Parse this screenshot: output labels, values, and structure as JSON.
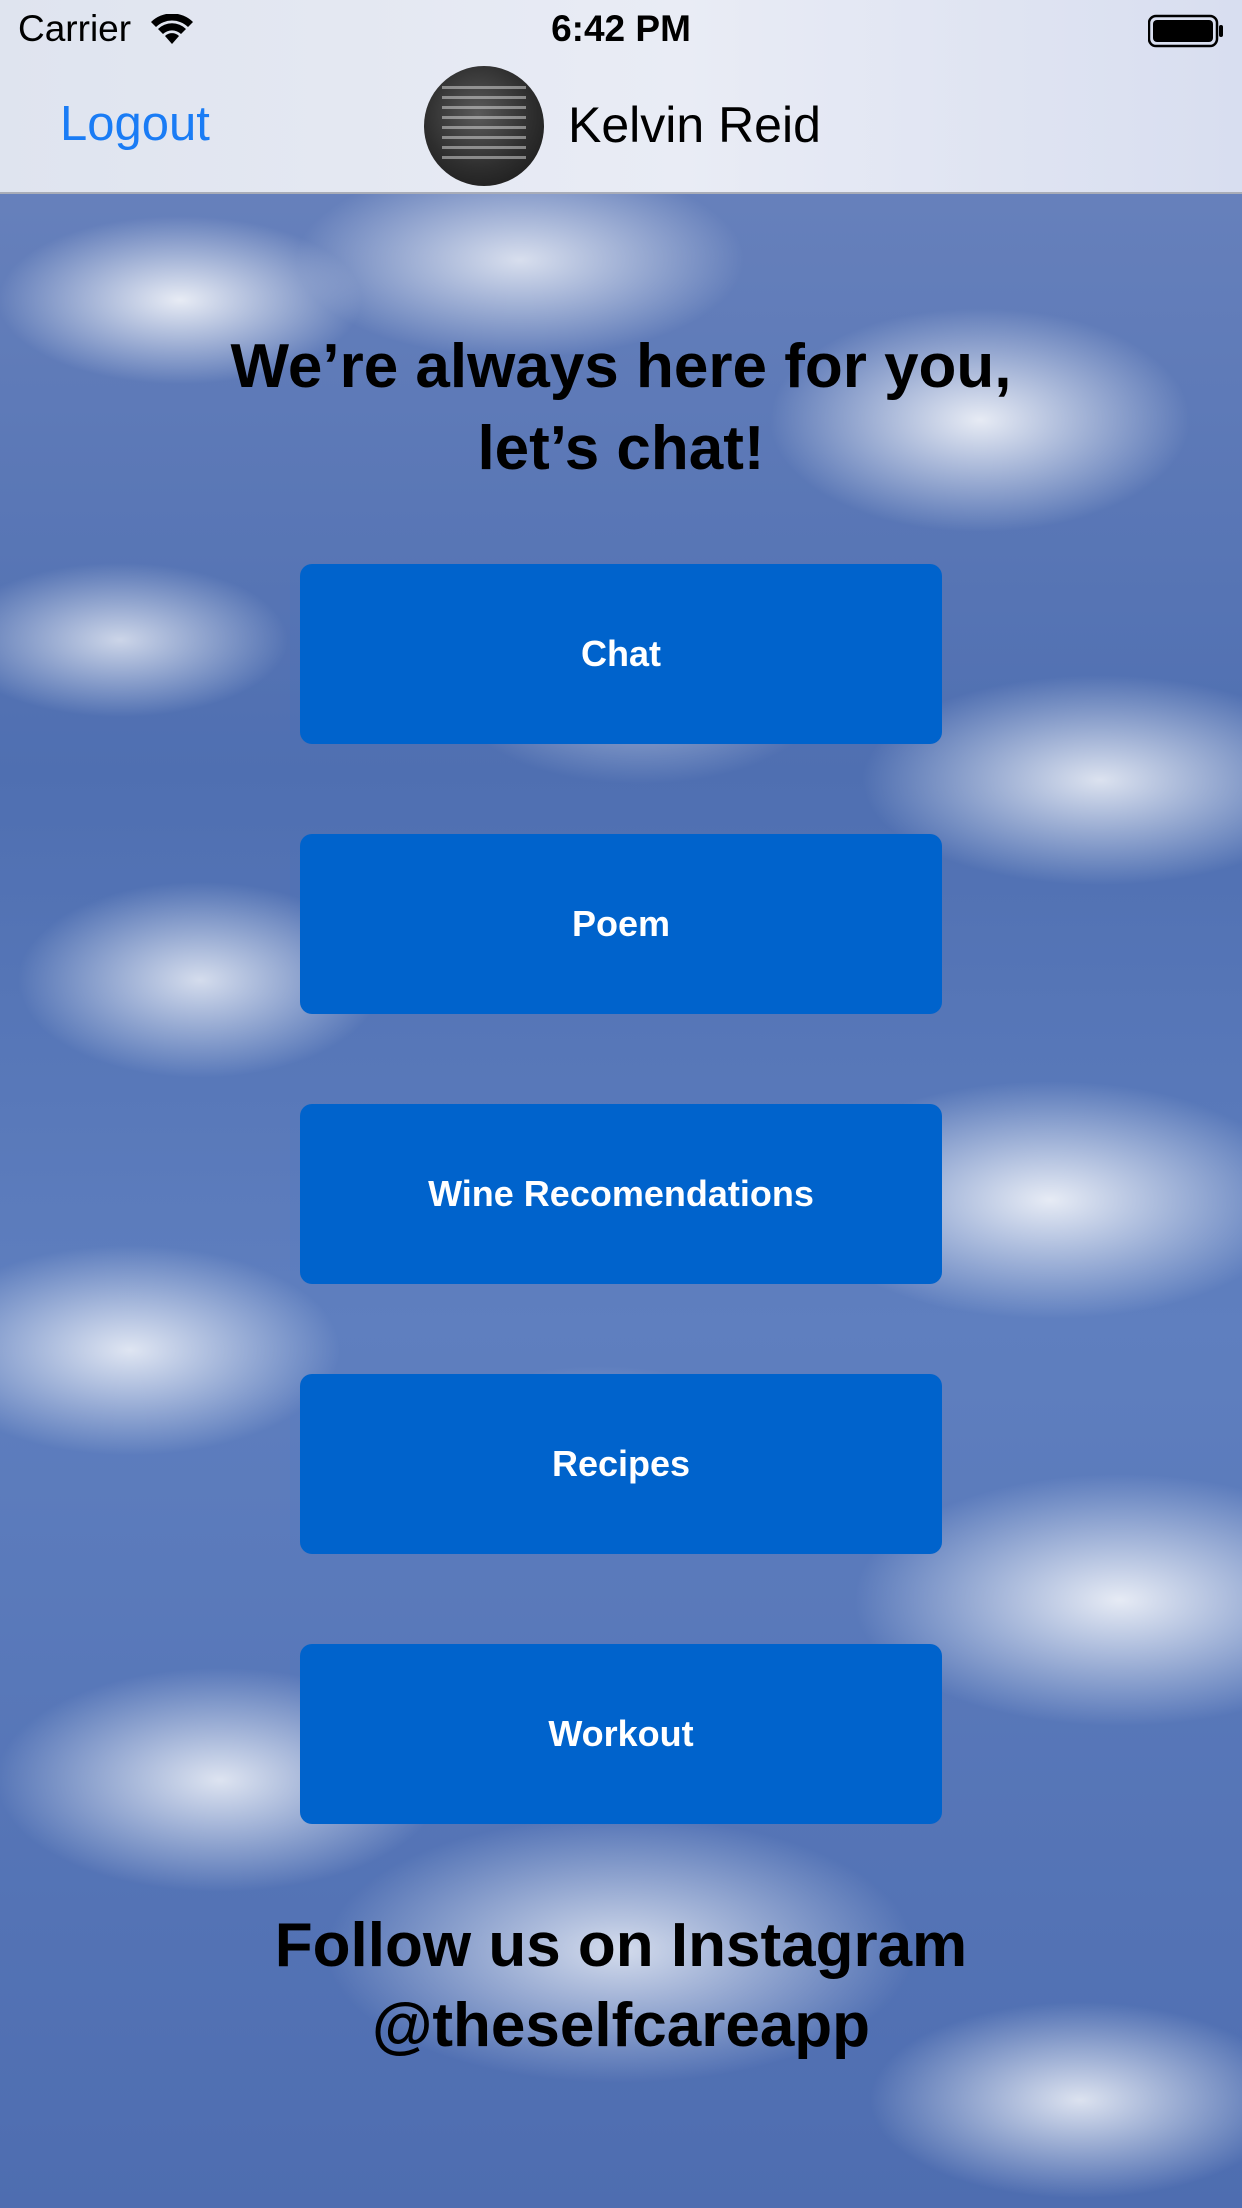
{
  "status_bar": {
    "carrier": "Carrier",
    "time": "6:42 PM"
  },
  "nav": {
    "logout_label": "Logout",
    "user_name": "Kelvin Reid"
  },
  "headline": {
    "line1": "We’re always here for you,",
    "line2": "let’s chat!"
  },
  "buttons": [
    {
      "label": "Chat"
    },
    {
      "label": "Poem"
    },
    {
      "label": "Wine Recomendations"
    },
    {
      "label": "Recipes"
    },
    {
      "label": "Workout"
    }
  ],
  "footer": {
    "line1": "Follow us on Instagram",
    "line2": "@theselfcareapp"
  },
  "colors": {
    "button_bg": "#0063cc",
    "link_blue": "#1a7cf5",
    "nav_bg": "#e3e7f1"
  },
  "icons": [
    "wifi-icon",
    "battery-icon",
    "avatar"
  ]
}
